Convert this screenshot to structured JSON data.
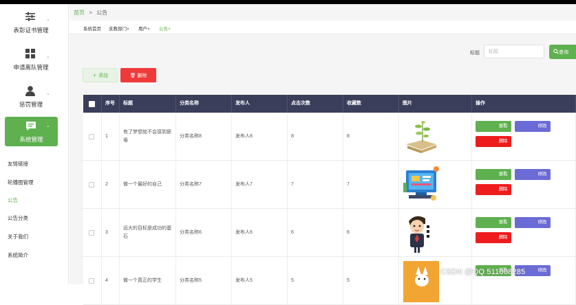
{
  "sidebar": {
    "menus": [
      {
        "label": "表彰证书管理",
        "icon": "sliders-icon"
      },
      {
        "label": "申请离队管理",
        "icon": "grid-icon"
      },
      {
        "label": "惩罚管理",
        "icon": "user-icon"
      },
      {
        "label": "系统管理",
        "icon": "message-icon",
        "active": true
      }
    ],
    "sub_items": [
      "友情链接",
      "轮播图管理",
      "公告",
      "公告分类",
      "关于我们",
      "系统简介"
    ],
    "active_sub": "公告"
  },
  "breadcrumb": {
    "home": "首页",
    "sep": ">",
    "current": "公告"
  },
  "tabs": [
    "系统首页",
    "支教部门×",
    "用户×",
    "公告×"
  ],
  "search": {
    "label": "标题",
    "placeholder": "标题",
    "button": "查询"
  },
  "toolbar": {
    "add": "添加",
    "delete": "删除"
  },
  "table": {
    "headers": [
      "序号",
      "标题",
      "分类名称",
      "发布人",
      "点击次数",
      "收藏数",
      "图片",
      "操作"
    ],
    "rows": [
      {
        "index": "1",
        "title": "有了梦想就不会感到疲倦",
        "category": "分类名称8",
        "publisher": "发布人8",
        "clicks": "8",
        "favorites": "8"
      },
      {
        "index": "2",
        "title": "做一个最好的自己",
        "category": "分类名称7",
        "publisher": "发布人7",
        "clicks": "7",
        "favorites": "7"
      },
      {
        "index": "3",
        "title": "远大的目标是成功的基石",
        "category": "分类名称6",
        "publisher": "发布人6",
        "clicks": "6",
        "favorites": "6"
      },
      {
        "index": "4",
        "title": "做一个真正的学生",
        "category": "分类名称5",
        "publisher": "发布人5",
        "clicks": "5",
        "favorites": "5"
      }
    ],
    "actions": {
      "view": "查看",
      "edit": "修改",
      "delete": "删除"
    }
  },
  "watermark": "CSDN @QQ 511008285",
  "colors": {
    "accent": "#5fb04f",
    "header": "#3a3e5a",
    "danger": "#ef3a3a",
    "edit": "#6b6bd6"
  }
}
